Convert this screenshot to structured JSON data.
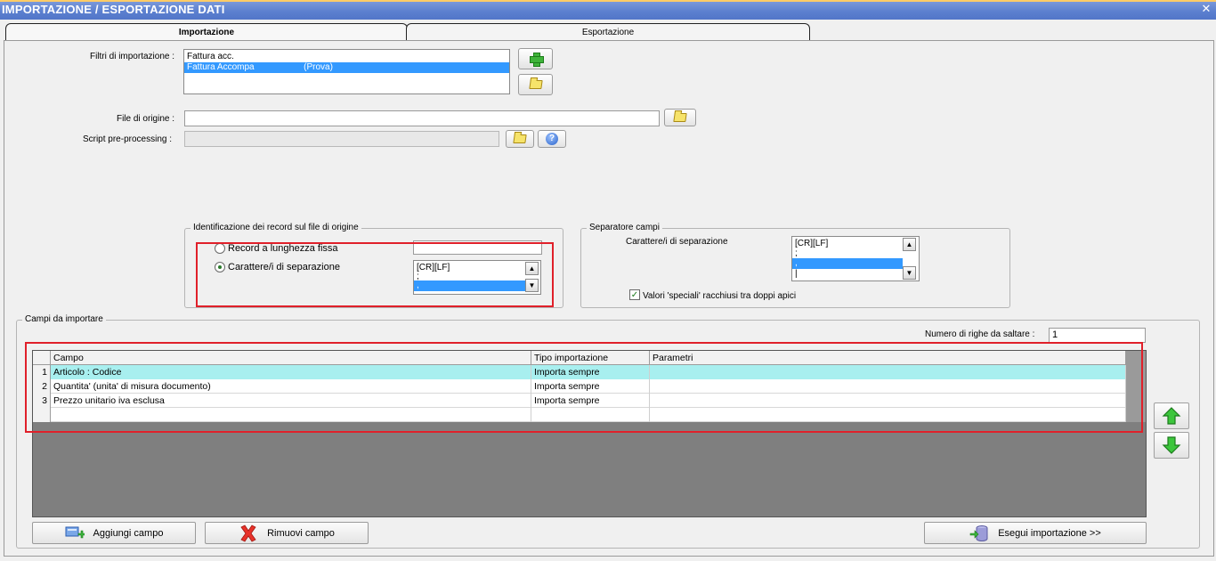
{
  "window": {
    "title": "IMPORTAZIONE / ESPORTAZIONE DATI",
    "close_glyph": "✕"
  },
  "tabs": [
    {
      "label": "Importazione",
      "active": true
    },
    {
      "label": "Esportazione",
      "active": false
    }
  ],
  "filters": {
    "label": "Filtri di importazione :",
    "items": [
      {
        "text": "Fattura acc.",
        "selected": false
      },
      {
        "text": "Fattura Accompa                    (Prova)",
        "selected": true
      }
    ],
    "add_icon": "plus-icon",
    "open_icon": "folder-icon"
  },
  "source": {
    "file_label": "File di origine :",
    "file_value": "",
    "script_label": "Script pre-processing :",
    "script_value": ""
  },
  "record_id": {
    "title": "Identificazione dei record sul file di origine",
    "option_fixed": "Record a lunghezza fissa",
    "option_sep": "Carattere/i di separazione",
    "selected_option": "Carattere/i di separazione",
    "fixed_value": "",
    "separators": [
      {
        "text": "[CR][LF]",
        "selected": false
      },
      {
        "text": ";",
        "selected": false
      },
      {
        "text": ",",
        "selected": true
      }
    ]
  },
  "field_sep": {
    "title": "Separatore campi",
    "label": "Carattere/i di separazione",
    "separators": [
      {
        "text": "[CR][LF]",
        "selected": false
      },
      {
        "text": ";",
        "selected": false
      },
      {
        "text": ",",
        "selected": true
      },
      {
        "text": "|",
        "selected": false
      }
    ],
    "quoted_label": "Valori 'speciali' racchiusi tra doppi apici",
    "quoted_checked": true,
    "check_glyph": "✓"
  },
  "fields": {
    "title": "Campi da importare",
    "skip_label": "Numero di righe da saltare  :",
    "skip_value": "1",
    "columns": [
      "Campo",
      "Tipo importazione",
      "Parametri"
    ],
    "rows": [
      {
        "num": "1",
        "campo": "Articolo : Codice",
        "tipo": "Importa sempre",
        "parametri": ""
      },
      {
        "num": "2",
        "campo": "Quantita' (unita' di misura documento)",
        "tipo": "Importa sempre",
        "parametri": ""
      },
      {
        "num": "3",
        "campo": "Prezzo unitario iva esclusa",
        "tipo": "Importa sempre",
        "parametri": ""
      }
    ]
  },
  "actions": {
    "add": "Aggiungi campo",
    "remove": "Rimuovi campo",
    "run": "Esegui importazione >>"
  },
  "glyphs": {
    "help": "?",
    "up": "▲",
    "down": "▼"
  }
}
